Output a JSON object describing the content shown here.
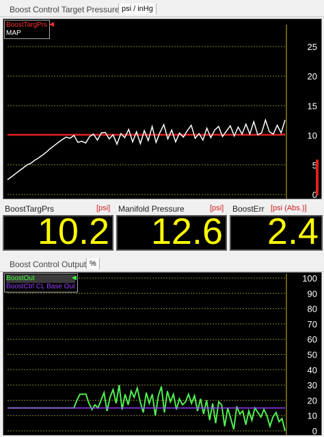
{
  "top_panel": {
    "title": "Boost Control Target Pressure",
    "unit_tab": "psi / inHg",
    "legend": [
      {
        "label": "BoostTargPrs",
        "color": "#ff3030"
      },
      {
        "label": "MAP",
        "color": "#ffffff"
      }
    ]
  },
  "gauges": [
    {
      "label": "BoostTargPrs",
      "unit": "[psi]",
      "value": "10.2"
    },
    {
      "label": "Manifold Pressure",
      "unit": "[psi]",
      "value": "12.6"
    },
    {
      "label": "BoostErr",
      "unit": "[psi (Abs.)]",
      "value": "2.4"
    }
  ],
  "bottom_panel": {
    "title": "Boost Control Output",
    "unit_tab": "%",
    "legend": [
      {
        "label": "BoostOut",
        "color": "#40ff40"
      },
      {
        "label": "BoostCtrl CL Base Out",
        "color": "#9a40ff"
      }
    ]
  },
  "chart_data": [
    {
      "type": "line",
      "title": "Boost Control Target Pressure",
      "ylim": [
        0,
        28
      ],
      "yticks": [
        0,
        5,
        10,
        15,
        20,
        25
      ],
      "grid": true,
      "legend_position": "top-left",
      "series": [
        {
          "name": "BoostTargPrs",
          "color": "#e02020",
          "values": [
            10.1,
            10.1,
            10.1,
            10.1,
            10.1,
            10.1,
            10.1,
            10.1,
            10.1,
            10.1,
            10.1,
            10.1,
            10.1,
            10.1,
            10.1,
            10.1,
            10.1,
            10.1,
            10.1,
            10.1,
            10.1,
            10.1,
            10.1,
            10.1,
            10.1,
            10.1,
            10.1,
            10.1,
            10.1,
            10.1,
            10.1,
            10.1,
            10.1,
            10.1,
            10.1,
            10.1,
            10.1,
            10.1,
            10.1,
            10.1,
            10.1,
            10.1,
            10.1,
            10.1,
            10.1,
            10.1,
            10.1,
            10.1,
            10.1,
            10.1,
            10.1,
            10.1,
            10.1,
            10.1,
            10.1,
            10.1,
            10.1,
            10.1,
            10.1,
            10.1,
            10.1,
            10.1,
            10.1,
            10.1,
            10.1,
            10.1,
            10.1,
            10.1,
            10.1,
            10.1,
            10.1,
            10.2
          ]
        },
        {
          "name": "MAP",
          "color": "#ffffff",
          "values": [
            2.5,
            3.0,
            3.5,
            4.0,
            4.5,
            5.0,
            5.3,
            5.8,
            6.2,
            6.7,
            7.2,
            7.8,
            8.3,
            8.8,
            9.3,
            9.7,
            9.5,
            10.0,
            8.8,
            9.0,
            8.7,
            9.8,
            10.2,
            9.2,
            10.4,
            10.5,
            9.4,
            10.1,
            8.5,
            10.3,
            9.6,
            11.0,
            8.9,
            10.6,
            8.6,
            10.8,
            9.1,
            11.5,
            8.8,
            10.5,
            11.8,
            9.4,
            10.9,
            8.9,
            10.4,
            9.7,
            10.8,
            11.7,
            9.5,
            10.3,
            9.2,
            11.2,
            9.6,
            10.9,
            11.5,
            9.8,
            10.7,
            11.6,
            9.9,
            11.4,
            10.2,
            11.9,
            10.2,
            12.3,
            10.1,
            10.4,
            12.6,
            10.6,
            10.2,
            11.7,
            10.4,
            12.6
          ]
        }
      ]
    },
    {
      "type": "line",
      "title": "Boost Control Output",
      "ylim": [
        0,
        100
      ],
      "yticks": [
        0,
        10,
        20,
        30,
        40,
        50,
        60,
        70,
        80,
        90,
        100
      ],
      "grid": true,
      "legend_position": "top-left",
      "series": [
        {
          "name": "BoostOut",
          "color": "#50f050",
          "values": [
            15,
            15,
            15,
            15,
            15,
            15,
            15,
            15,
            15,
            15,
            15,
            15,
            15,
            15,
            15,
            15,
            15,
            15,
            15,
            15,
            15,
            15,
            15,
            20,
            24,
            24,
            24,
            18,
            14,
            17,
            15,
            20,
            25,
            13,
            22,
            27,
            18,
            30,
            14,
            24,
            17,
            26,
            22,
            28,
            19,
            12,
            25,
            18,
            24,
            10,
            23,
            29,
            12,
            26,
            19,
            24,
            14,
            21,
            17,
            19,
            24,
            18,
            23,
            13,
            21,
            11,
            20,
            7,
            18,
            5,
            19,
            17,
            3,
            15,
            8,
            1,
            16,
            11,
            13,
            4,
            13,
            7,
            15,
            12,
            9,
            14,
            10,
            3,
            9,
            12,
            6,
            8,
            0
          ]
        },
        {
          "name": "BoostCtrl CL Base Out",
          "color": "#9a3cff",
          "values": [
            15,
            15,
            15,
            15,
            15,
            15,
            15,
            15,
            15,
            15,
            15,
            15,
            15,
            15,
            15,
            15,
            15,
            15,
            15,
            15,
            15,
            15,
            15,
            15,
            15,
            15,
            15,
            15,
            15,
            15,
            15,
            15,
            15,
            15,
            15,
            15,
            15,
            15,
            15,
            15,
            15,
            15,
            15,
            15,
            15,
            15,
            15,
            15,
            15,
            15,
            15,
            15,
            15,
            15,
            15,
            15,
            15,
            15,
            15,
            15,
            15,
            15,
            15,
            15,
            15,
            15,
            15,
            15,
            15,
            15,
            15,
            15,
            15,
            15,
            15,
            15,
            15,
            15,
            15,
            15,
            15,
            15,
            15,
            15,
            15,
            15,
            15,
            15,
            15,
            15,
            15,
            15,
            15
          ]
        }
      ]
    }
  ]
}
